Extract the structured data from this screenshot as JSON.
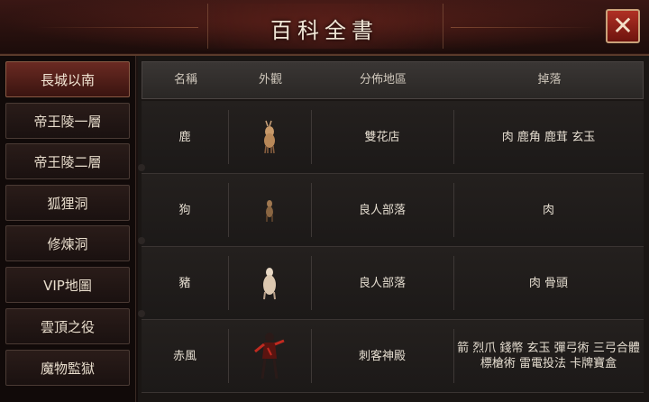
{
  "window": {
    "title": "百科全書"
  },
  "sidebar": {
    "items": [
      {
        "label": "長城以南",
        "active": true
      },
      {
        "label": "帝王陵一層",
        "active": false
      },
      {
        "label": "帝王陵二層",
        "active": false
      },
      {
        "label": "狐狸洞",
        "active": false
      },
      {
        "label": "修煉洞",
        "active": false
      },
      {
        "label": "VIP地圖",
        "active": false
      },
      {
        "label": "雲頂之役",
        "active": false
      },
      {
        "label": "魔物監獄",
        "active": false
      }
    ]
  },
  "table": {
    "headers": {
      "name": "名稱",
      "appearance": "外觀",
      "location": "分佈地區",
      "drops": "掉落"
    },
    "rows": [
      {
        "name": "鹿",
        "sprite": "deer-icon",
        "location": "雙花店",
        "drops_line1": "肉 鹿角 鹿茸 玄玉",
        "drops_line2": ""
      },
      {
        "name": "狗",
        "sprite": "dog-icon",
        "location": "良人部落",
        "drops_line1": "肉",
        "drops_line2": ""
      },
      {
        "name": "豬",
        "sprite": "pig-icon",
        "location": "良人部落",
        "drops_line1": "肉 骨頭",
        "drops_line2": ""
      },
      {
        "name": "赤風",
        "sprite": "warrior-icon",
        "location": "刺客神殿",
        "drops_line1": "箭 烈爪 錢幣 玄玉 彈弓術 三弓合體",
        "drops_line2": "標槍術 雷電投法 卡牌寶盒"
      }
    ]
  },
  "colors": {
    "accent": "#6a2a22",
    "close": "#b03024",
    "border": "#c9a27a"
  }
}
